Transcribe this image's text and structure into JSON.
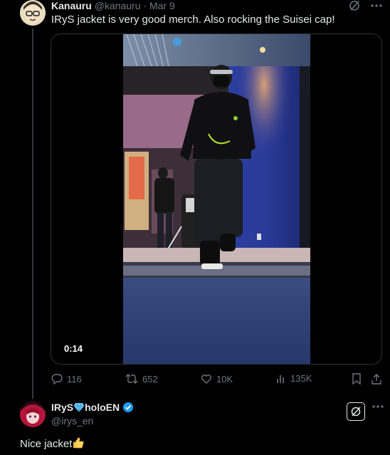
{
  "tweet": {
    "author_name": "Kanauru",
    "author_handle": "@kanauru",
    "separator": "·",
    "date": "Mar 9",
    "text": "IRyS jacket is very good merch. Also rocking the Suisei cap!",
    "video_time": "0:14"
  },
  "actions": {
    "replies": "116",
    "reposts": "652",
    "likes": "10K",
    "views": "135K"
  },
  "reply": {
    "author_name": "IRyS",
    "name_suffix": "holoEN",
    "author_handle": "@irys_en",
    "text": "Nice jacket"
  },
  "colors": {
    "background": "#000000",
    "text": "#e7e9ea",
    "muted": "#71767b",
    "verified": "#1d9bf0",
    "divider": "#2f3336"
  },
  "icons": [
    "grok-icon",
    "more-icon",
    "reply-icon",
    "repost-icon",
    "like-icon",
    "views-icon",
    "bookmark-icon",
    "share-icon",
    "verified-icon",
    "diamond-emoji",
    "thumbs-up-emoji"
  ]
}
